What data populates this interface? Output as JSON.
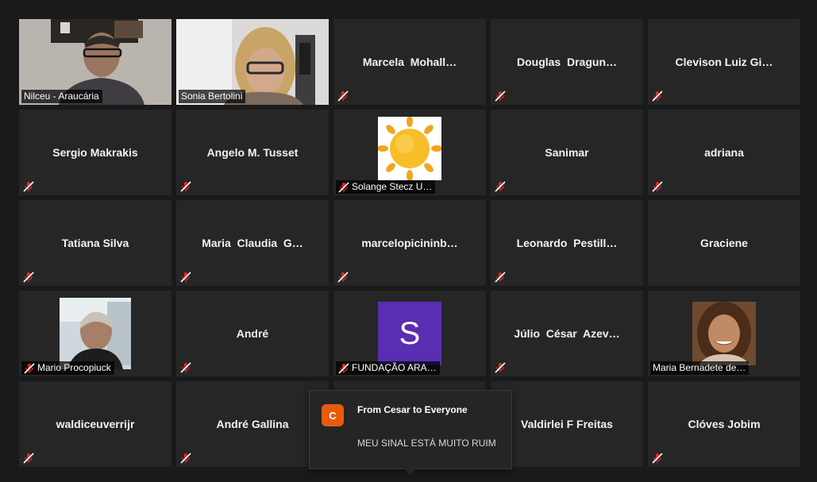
{
  "participants": [
    {
      "name": "Nilceu - Araucária",
      "type": "video"
    },
    {
      "name": "Sonia Bertolini",
      "type": "video"
    },
    {
      "name": "Marcela  Mohall…",
      "type": "name"
    },
    {
      "name": "Douglas  Dragun…",
      "type": "name"
    },
    {
      "name": "Clevison Luiz Gi…",
      "type": "name"
    },
    {
      "name": "Sergio Makrakis",
      "type": "name"
    },
    {
      "name": "Angelo M. Tusset",
      "type": "name"
    },
    {
      "name": "Solange Stecz U…",
      "type": "sun-avatar"
    },
    {
      "name": "Sanimar",
      "type": "name"
    },
    {
      "name": "adriana",
      "type": "name"
    },
    {
      "name": "Tatiana Silva",
      "type": "name"
    },
    {
      "name": "Maria  Claudia  G…",
      "type": "name"
    },
    {
      "name": "marcelopicininb…",
      "type": "name"
    },
    {
      "name": "Leonardo  Pestill…",
      "type": "name"
    },
    {
      "name": "Graciene",
      "type": "name"
    },
    {
      "name": "Mario Procopiuck",
      "type": "photo-avatar"
    },
    {
      "name": "André",
      "type": "name"
    },
    {
      "name": "FUNDAÇÃO ARA…",
      "type": "letter-avatar",
      "letter": "S"
    },
    {
      "name": "Júlio  César  Azev…",
      "type": "name"
    },
    {
      "name": "Maria Bernadete de…",
      "type": "photo-avatar-nomic"
    },
    {
      "name": "waldiceuverrijr",
      "type": "name"
    },
    {
      "name": "André Gallina",
      "type": "name"
    },
    {
      "name": "",
      "type": "hidden"
    },
    {
      "name": "Valdirlei F Freitas",
      "type": "name"
    },
    {
      "name": "Clóves Jobim",
      "type": "name"
    }
  ],
  "chat": {
    "avatar_letter": "C",
    "from": "From Cesar to Everyone",
    "message": "MEU SINAL ESTÁ MUITO RUIM"
  },
  "colors": {
    "background": "#1a1a1a",
    "tile": "#262626",
    "muted_icon": "#e02828",
    "chat_avatar": "#e85b0c",
    "letter_avatar": "#5a2db2"
  }
}
